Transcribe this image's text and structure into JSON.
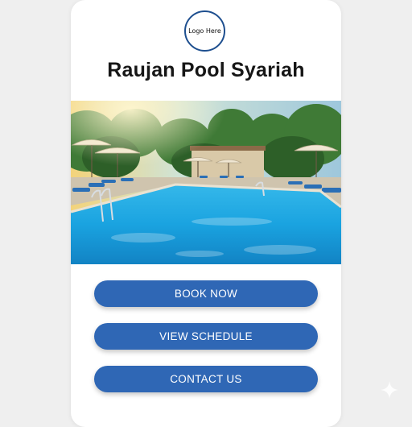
{
  "brand": {
    "logo_text": "Logo Here",
    "title": "Raujan Pool Syariah"
  },
  "hero": {
    "alt": "Outdoor swimming pool with palm trees, umbrellas and blue loungers",
    "icon": "pool-photo"
  },
  "actions": [
    {
      "label": "BOOK NOW"
    },
    {
      "label": "VIEW SCHEDULE"
    },
    {
      "label": "CONTACT US"
    }
  ],
  "colors": {
    "primary": "#2f67b5",
    "logo_border": "#1e4f8f",
    "background": "#efefef",
    "card": "#ffffff",
    "water": "#1aa3e0"
  },
  "decor": {
    "corner_icon": "sparkle-icon"
  }
}
